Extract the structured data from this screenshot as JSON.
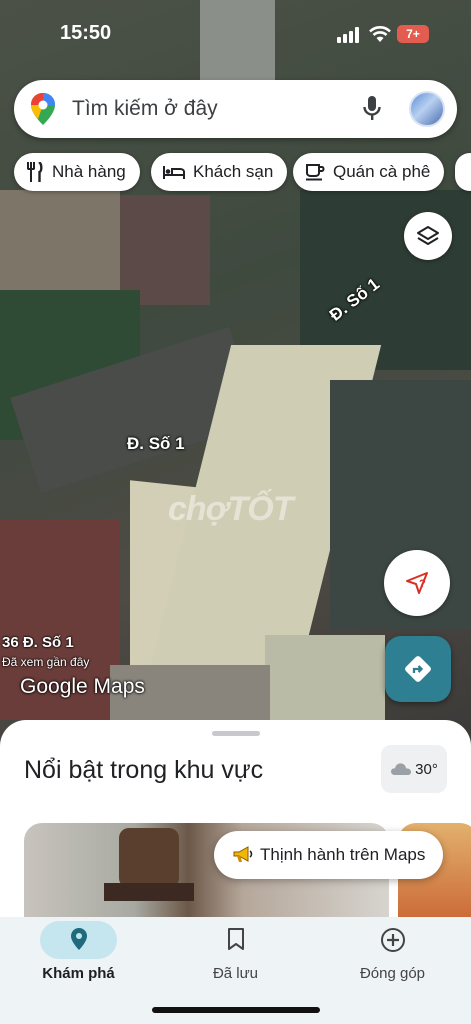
{
  "status_bar": {
    "time": "15:50",
    "battery": "7+"
  },
  "search": {
    "placeholder": "Tìm kiếm ở đây"
  },
  "chips": [
    {
      "label": "Nhà hàng",
      "icon": "fork-knife-icon"
    },
    {
      "label": "Khách sạn",
      "icon": "bed-icon"
    },
    {
      "label": "Quán cà phê",
      "icon": "coffee-cup-icon"
    }
  ],
  "map": {
    "road_labels": [
      "Đ. Số 1",
      "Đ. Số 1"
    ],
    "place_label": "36 Đ. Số 1",
    "place_sublabel": "Đã xem gần đây",
    "logo": "Google Maps",
    "watermark": "chợTỐT"
  },
  "sheet": {
    "title": "Nổi bật trong khu vực",
    "weather": "30°",
    "trending_label": "Thịnh hành trên Maps"
  },
  "nav": [
    {
      "label": "Khám phá",
      "icon": "explore-pin-icon",
      "active": true
    },
    {
      "label": "Đã lưu",
      "icon": "bookmark-icon",
      "active": false
    },
    {
      "label": "Đóng góp",
      "icon": "add-circle-icon",
      "active": false
    }
  ],
  "colors": {
    "accent": "#2f7f92",
    "active_pill": "#c5e6ee",
    "battery": "#e25c4f"
  }
}
